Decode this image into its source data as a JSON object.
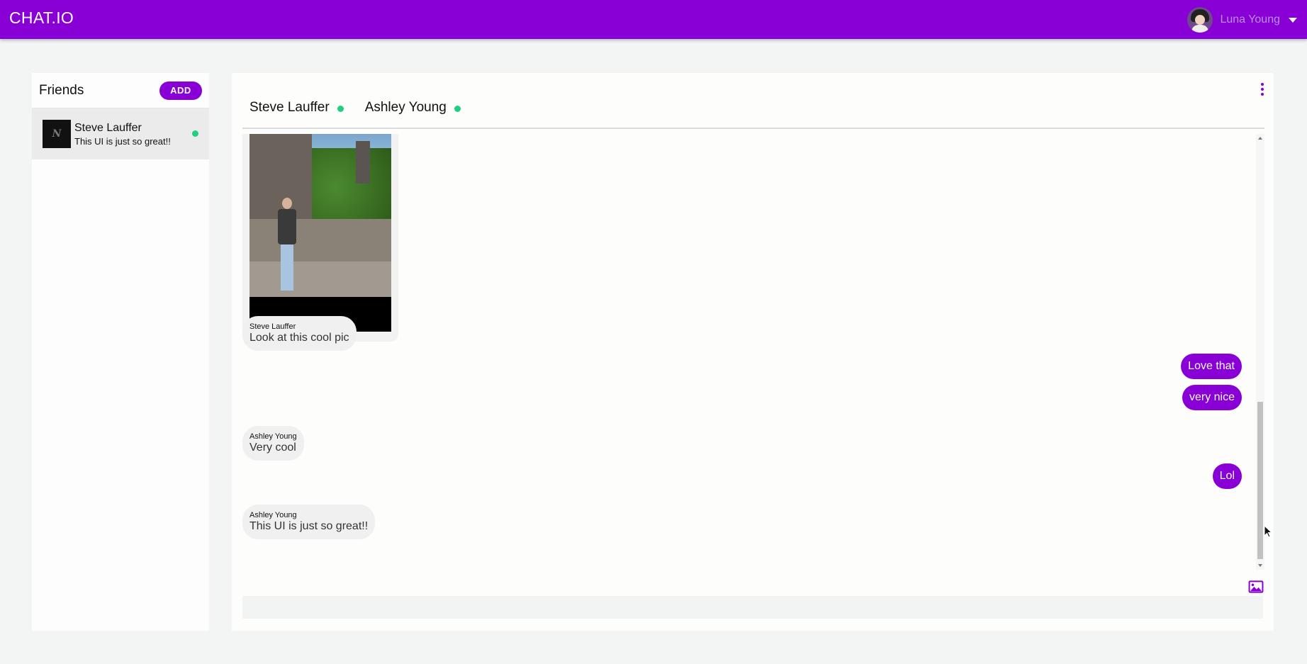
{
  "app": {
    "brand": "CHAT.IO",
    "user_name": "Luna Young",
    "accent_color": "#8800d6",
    "online_color": "#1fd07e"
  },
  "friends": {
    "title": "Friends",
    "add_label": "ADD",
    "items": [
      {
        "name": "Steve Lauffer",
        "preview": "This UI is just so great!!",
        "avatar_letter": "N",
        "status": "online"
      }
    ]
  },
  "chat": {
    "tabs": [
      {
        "label": "Steve Lauffer",
        "status": "online"
      },
      {
        "label": "Ashley Young",
        "status": "online"
      }
    ],
    "messages": [
      {
        "type": "image",
        "direction": "incoming"
      },
      {
        "type": "text",
        "direction": "incoming",
        "sender": "Steve Lauffer",
        "text": "Look at this cool pic"
      },
      {
        "type": "text",
        "direction": "outgoing",
        "text": "Love that"
      },
      {
        "type": "text",
        "direction": "outgoing",
        "text": "very nice"
      },
      {
        "type": "text",
        "direction": "incoming",
        "sender": "Ashley Young",
        "text": "Very cool"
      },
      {
        "type": "text",
        "direction": "outgoing",
        "text": "Lol"
      },
      {
        "type": "text",
        "direction": "incoming",
        "sender": "Ashley Young",
        "text": "This UI is just so great!!"
      }
    ],
    "composer": {
      "value": "",
      "placeholder": ""
    },
    "icons": [
      "image-icon",
      "emoji-icon",
      "more-vert-icon"
    ]
  }
}
